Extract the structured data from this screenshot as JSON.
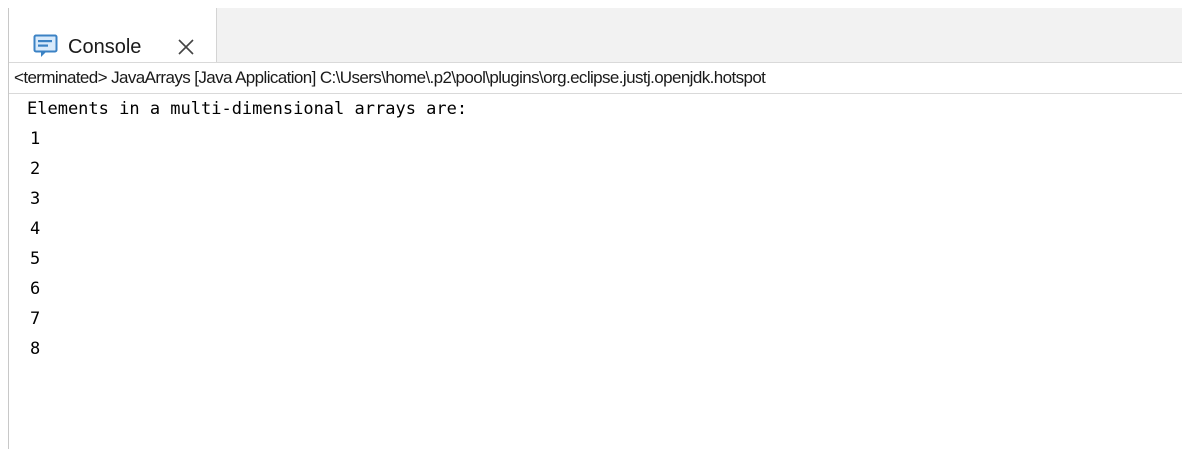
{
  "console_tab": {
    "label": "Console",
    "icon": "console-icon",
    "close_icon": "close-icon"
  },
  "status": {
    "text": "<terminated> JavaArrays [Java Application] C:\\Users\\home\\.p2\\pool\\plugins\\org.eclipse.justj.openjdk.hotspot"
  },
  "output": {
    "lines": [
      "Elements in a multi-dimensional arrays are:",
      "1",
      "2",
      "3",
      "4",
      "5",
      "6",
      "7",
      "8"
    ]
  },
  "colors": {
    "icon_blue": "#3b82c4",
    "tab_bar_background": "#f2f2f2",
    "text": "#000000"
  }
}
